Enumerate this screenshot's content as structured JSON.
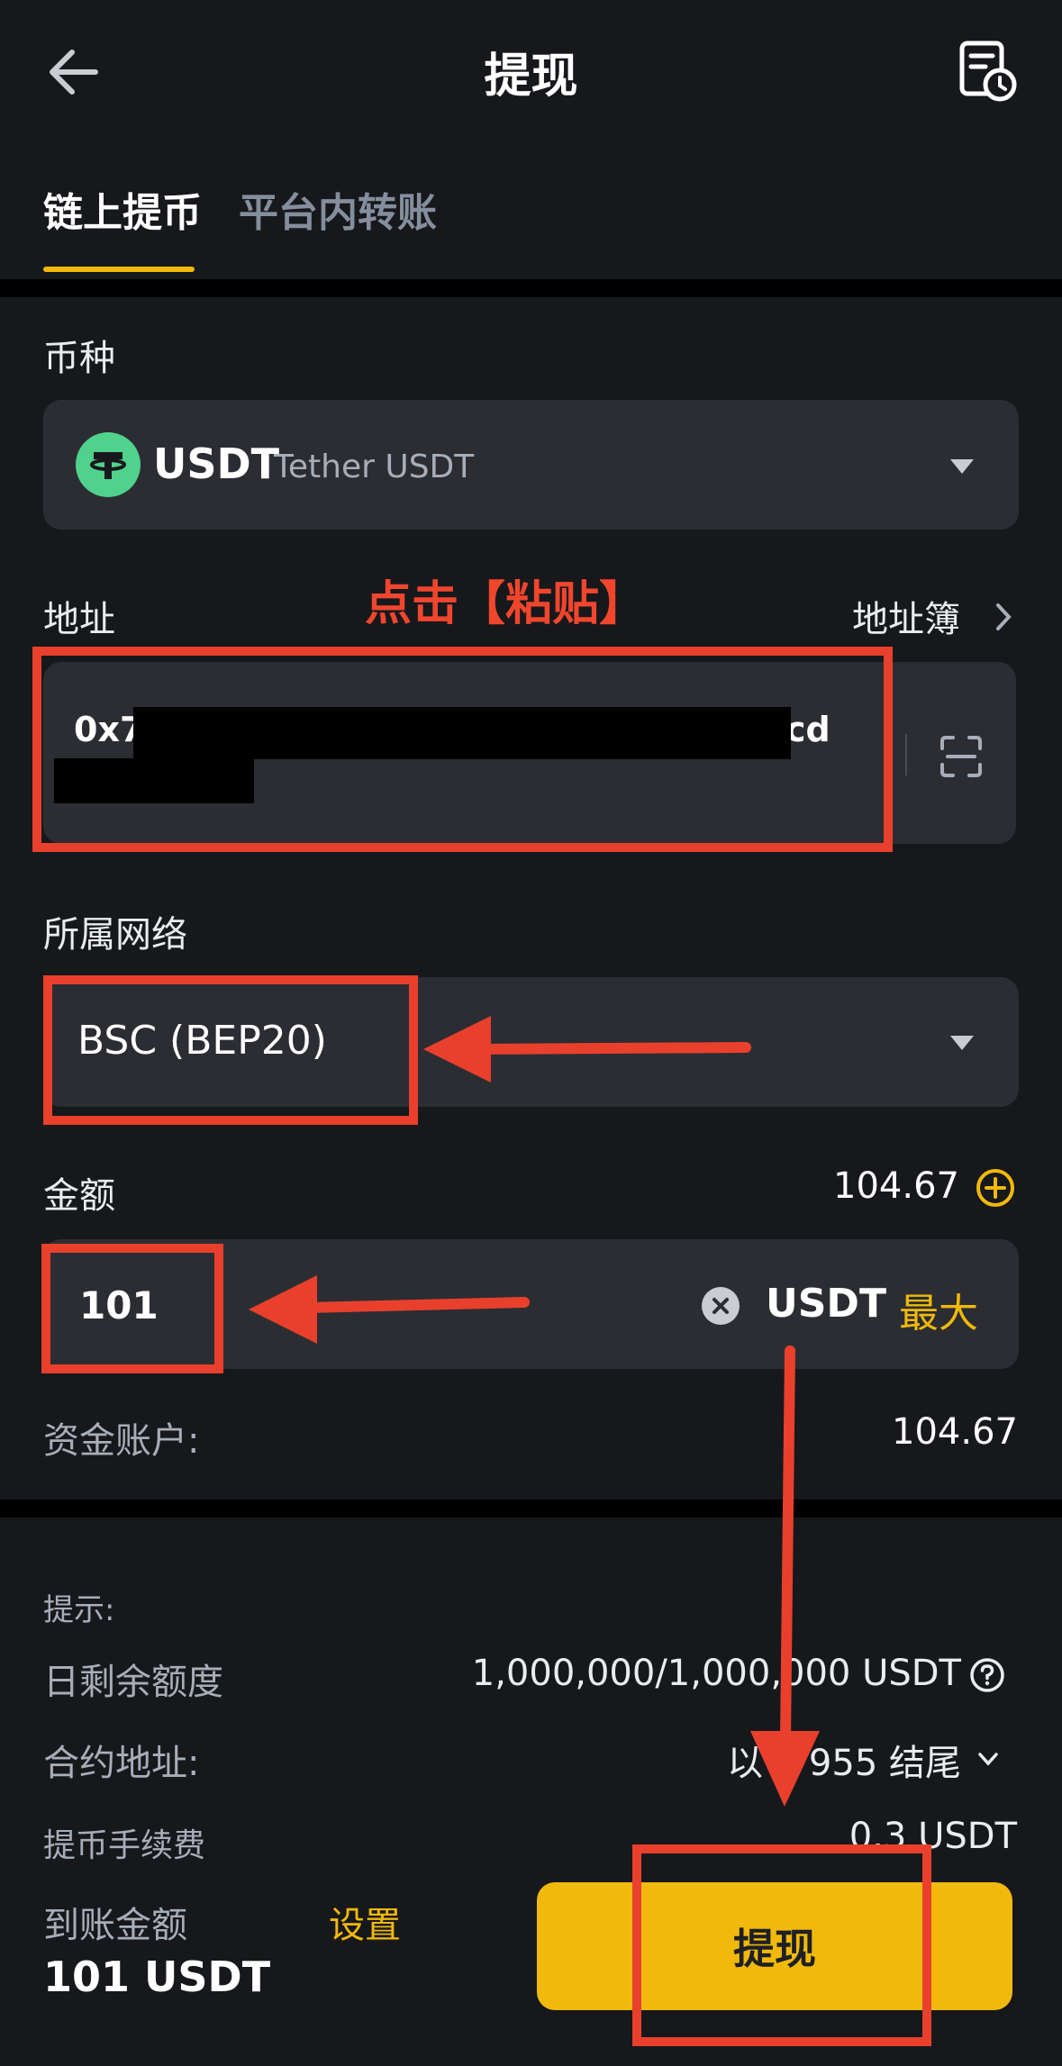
{
  "header": {
    "title": "提现",
    "back_icon": "arrow-left-icon",
    "history_icon": "history-record-icon"
  },
  "tabs": [
    {
      "label": "链上提币",
      "active": true
    },
    {
      "label": "平台内转账",
      "active": false
    }
  ],
  "coin": {
    "label": "币种",
    "symbol": "USDT",
    "name": "Tether USDT",
    "icon": "tether-icon"
  },
  "address": {
    "label": "地址",
    "book_label": "地址簿",
    "value_start": "0x7",
    "value_end": "cd",
    "redacted": true
  },
  "network": {
    "label": "所属网络",
    "value": "BSC (BEP20)"
  },
  "amount": {
    "label": "金额",
    "balance": "104.67",
    "value": "101",
    "unit": "USDT",
    "max_label": "最大"
  },
  "funding": {
    "label": "资金账户:",
    "value": "104.67"
  },
  "tips": {
    "heading": "提示:",
    "quota_label": "日剩余额度",
    "quota_value": "1,000,000/1,000,000 USDT",
    "contract_label": "合约地址:",
    "contract_value": "以 1   955 结尾",
    "fee_label": "提币手续费",
    "fee_value": "0.3 USDT"
  },
  "footer": {
    "receive_label": "到账金额",
    "settings_label": "设置",
    "receive_amount": "101 USDT",
    "submit_label": "提现"
  },
  "annotation": {
    "paste_hint": "点击【粘贴】",
    "color": "#E8402C"
  },
  "colors": {
    "background": "#17181C",
    "field": "#2B2D33",
    "accent": "#F0B90B",
    "annotation": "#E8402C"
  }
}
